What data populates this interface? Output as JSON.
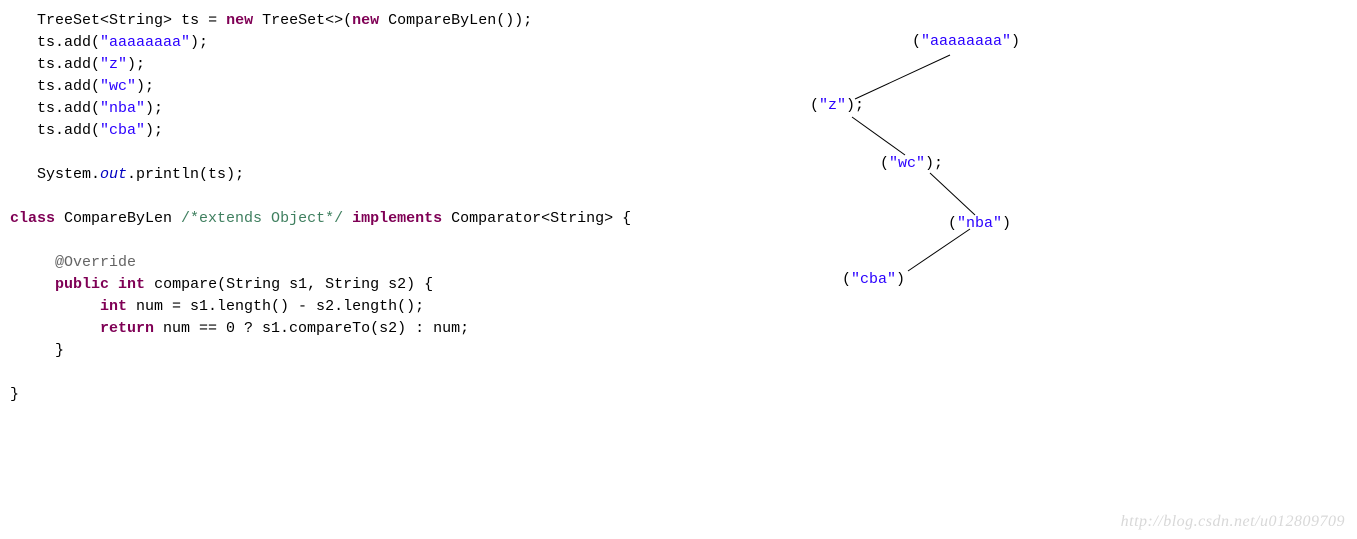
{
  "code": {
    "l1": {
      "type": "TreeSet<String>",
      "var": "ts",
      "assign": "= ",
      "new1": "new",
      "ctor": " TreeSet<>(",
      "new2": "new",
      "ctor2": " CompareByLen());"
    },
    "l2": {
      "call": "ts.add(",
      "arg": "\"aaaaaaaa\"",
      "end": ");"
    },
    "l3": {
      "call": "ts.add(",
      "arg": "\"z\"",
      "end": ");"
    },
    "l4": {
      "call": "ts.add(",
      "arg": "\"wc\"",
      "end": ");"
    },
    "l5": {
      "call": "ts.add(",
      "arg": "\"nba\"",
      "end": ");"
    },
    "l6": {
      "call": "ts.add(",
      "arg": "\"cba\"",
      "end": ");"
    },
    "l7": {
      "sys": "System.",
      "out": "out",
      "rest": ".println(ts);"
    },
    "l8": {
      "kw_class": "class",
      "name": " CompareByLen ",
      "cmt": "/*extends Object*/",
      "sp": " ",
      "kw_impl": "implements",
      "rest": " Comparator<String> {"
    },
    "l9": {
      "ann": "@Override"
    },
    "l10": {
      "kw_pub": "public",
      "sp1": " ",
      "kw_int": "int",
      "rest": " compare(String s1, String s2) {"
    },
    "l11": {
      "kw_int": "int",
      "rest": " num = s1.length() - s2.length();"
    },
    "l12": {
      "kw_ret": "return",
      "rest": " num == 0 ? s1.compareTo(s2) : num;"
    },
    "l13": {
      "c": "}"
    },
    "l14": {
      "c": "}"
    }
  },
  "tree": {
    "n1": {
      "open": "(",
      "val": "\"aaaaaaaa\"",
      "close": ")"
    },
    "n2": {
      "open": "(",
      "val": "\"z\"",
      "close": ");"
    },
    "n3": {
      "open": "(",
      "val": "\"wc\"",
      "close": ");"
    },
    "n4": {
      "open": "(",
      "val": "\"nba\"",
      "close": ")"
    },
    "n5": {
      "open": "(",
      "val": "\"cba\"",
      "close": ")"
    }
  },
  "watermark": "http://blog.csdn.net/u012809709"
}
